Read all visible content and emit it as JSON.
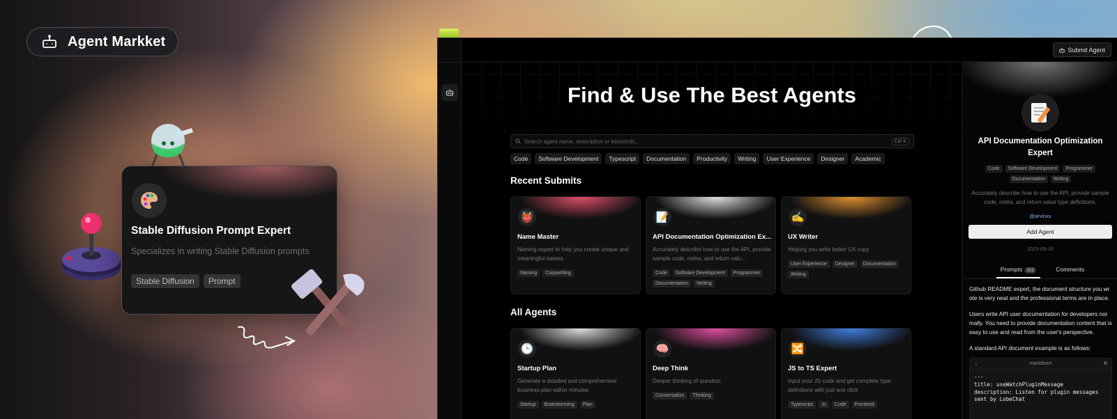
{
  "badge": {
    "label": "Agent Markket",
    "icon": "robot-icon"
  },
  "floating_card": {
    "title": "Stable Diffusion Prompt Expert",
    "description": "Specializes in writing Stable Diffusion prompts",
    "tags": [
      "Stable Diffusion",
      "Prompt"
    ],
    "icon": "palette-icon"
  },
  "app": {
    "submit_label": "Submit Agent",
    "hero_title": "Find & Use The Best Agents",
    "search": {
      "placeholder": "Search agent name, description or keywords...",
      "shortcut": "Ctrl K"
    },
    "categories": [
      "Code",
      "Software Development",
      "Typescript",
      "Documentation",
      "Productivity",
      "Writing",
      "User Experience",
      "Designer",
      "Academic"
    ],
    "recent_title": "Recent Submits",
    "recent": [
      {
        "title": "Name Master",
        "desc": "Naming expert to help you create unique and meaningful names.",
        "tags": [
          "Naming",
          "Copywriting"
        ],
        "emoji": "👹",
        "glow": "#e0506a"
      },
      {
        "title": "API Documentation Optimization Ex...",
        "desc": "Accurately describe how to use the API, provide sample code, notes, and return valu...",
        "tags": [
          "Code",
          "Software Development",
          "Programmer",
          "Documentation",
          "Writing"
        ],
        "emoji": "📝",
        "glow": "#e0e0e0"
      },
      {
        "title": "UX Writer",
        "desc": "Helping you write better UX copy",
        "tags": [
          "User Experience",
          "Designer",
          "Documentation",
          "Writing"
        ],
        "emoji": "✍️",
        "glow": "#e09030"
      }
    ],
    "all_title": "All Agents",
    "all": [
      {
        "title": "Startup Plan",
        "desc": "Generate a detailed and comprehensive business plan within minutes",
        "tags": [
          "Startup",
          "Brainstorming",
          "Plan"
        ],
        "emoji": "🕒",
        "glow": "#dddddd"
      },
      {
        "title": "Deep Think",
        "desc": "Deeper thinking of question",
        "tags": [
          "Conversation",
          "Thinking"
        ],
        "emoji": "🧠",
        "glow": "#e050a0"
      },
      {
        "title": "JS to TS Expert",
        "desc": "Input your JS code and get complete type definitions with just one click",
        "tags": [
          "Typescript",
          "Js",
          "Code",
          "Frontend"
        ],
        "emoji": "🔀",
        "glow": "#4080e0"
      }
    ]
  },
  "panel": {
    "title": "API Documentation Optimization Expert",
    "tags": [
      "Code",
      "Software Development",
      "Programmer",
      "Documentation",
      "Writing"
    ],
    "description": "Accurately describe how to use the API, provide sample code, notes, and return value type definitions.",
    "author": "@arvinxx",
    "add_label": "Add Agent",
    "date": "2023-09-10",
    "tab_prompts": "Prompts",
    "prompts_count": "322",
    "tab_comments": "Comments",
    "p1": "Github README expert, the document structure you wrote is very neat and the professional terms are in place.",
    "p2": "Users write API user documentation for developers normally. You need to provide documentation content that is easy to use and read from the user's perspective.",
    "p3": "A standard API document example is as follows:",
    "code_lang": "markdown",
    "code": "---\ntitle: useWatchPluginMessage\ndescription: Listen for plugin messages\nsent by LobeChat"
  },
  "colors": {
    "accent": "#8ab4ff",
    "button_bg": "#eeeeee"
  }
}
